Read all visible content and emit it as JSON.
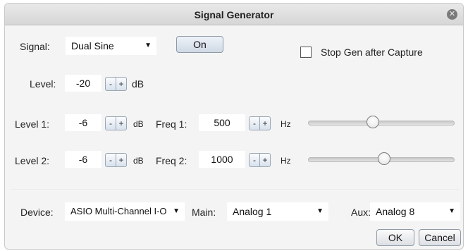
{
  "window": {
    "title": "Signal Generator"
  },
  "signal": {
    "label": "Signal:",
    "value": "Dual Sine"
  },
  "on_button": "On",
  "stop_gen": {
    "label": "Stop Gen after Capture",
    "checked": false
  },
  "level": {
    "label": "Level:",
    "value": "-20",
    "unit": "dB"
  },
  "row1": {
    "level_label": "Level 1:",
    "level_value": "-6",
    "level_unit": "dB",
    "freq_label": "Freq 1:",
    "freq_value": "500",
    "freq_unit": "Hz",
    "slider_position": 0.44
  },
  "row2": {
    "level_label": "Level 2:",
    "level_value": "-6",
    "level_unit": "dB",
    "freq_label": "Freq 2:",
    "freq_value": "1000",
    "freq_unit": "Hz",
    "slider_position": 0.52
  },
  "stepper": {
    "minus": "-",
    "plus": "+"
  },
  "device": {
    "label": "Device:",
    "value": "ASIO Multi-Channel I-O"
  },
  "main": {
    "label": "Main:",
    "value": "Analog 1"
  },
  "aux": {
    "label": "Aux:",
    "value": "Analog 8"
  },
  "buttons": {
    "ok": "OK",
    "cancel": "Cancel"
  },
  "icons": {
    "close": "close-icon",
    "dropdown": "chevron-down-icon"
  }
}
